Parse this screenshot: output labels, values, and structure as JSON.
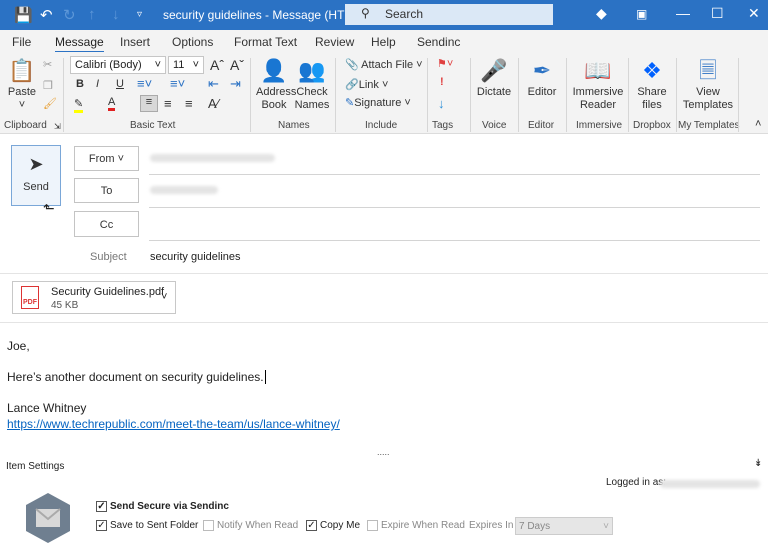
{
  "titlebar": {
    "title": "security guidelines  -  Message (HTML)",
    "search_placeholder": "Search",
    "icons": [
      "save-icon",
      "undo-icon",
      "redo-icon",
      "up-icon",
      "down-icon",
      "customize-icon",
      "diamond-icon",
      "restore-icon",
      "minimize-icon",
      "maximize-icon",
      "close-icon"
    ]
  },
  "tabs": [
    "File",
    "Message",
    "Insert",
    "Options",
    "Format Text",
    "Review",
    "Help",
    "Sendinc"
  ],
  "active_tab": "Message",
  "ribbon": {
    "paste": "Paste",
    "font": "Calibri (Body)",
    "size": "11",
    "address_book": [
      "Address",
      "Book"
    ],
    "check_names": [
      "Check",
      "Names"
    ],
    "attach_file": "Attach File",
    "link": "Link",
    "signature": "Signature",
    "dictate": "Dictate",
    "editor": "Editor",
    "immersive_reader": [
      "Immersive",
      "Reader"
    ],
    "share_files": [
      "Share",
      "files"
    ],
    "view_templates": [
      "View",
      "Templates"
    ],
    "groups": [
      "Clipboard",
      "Basic Text",
      "Names",
      "Include",
      "Tags",
      "Voice",
      "Editor",
      "Immersive",
      "Dropbox",
      "My Templates"
    ],
    "highlight_color": "#ffff00",
    "font_color": "#e02020"
  },
  "compose": {
    "send": "Send",
    "from": "From",
    "to": "To",
    "cc": "Cc",
    "subject_label": "Subject",
    "subject": "security guidelines"
  },
  "attachment": {
    "name": "Security Guidelines.pdf",
    "size": "45 KB",
    "type": "PDF"
  },
  "body": {
    "greeting": "Joe,",
    "line1": "Here’s another document on security guidelines.",
    "signature": "Lance Whitney",
    "link": "https://www.techrepublic.com/meet-the-team/us/lance-whitney/"
  },
  "sendinc": {
    "divider": ".....",
    "title": "Item Settings",
    "logged_in": "Logged in as:",
    "send_secure": "Send Secure via Sendinc",
    "save_sent": "Save to Sent Folder",
    "notify": "Notify When Read",
    "copy_me": "Copy Me",
    "expire": "Expire When Read",
    "expires_in": "Expires In",
    "expires_value": "7 Days",
    "checked": {
      "send_secure": true,
      "save_sent": true,
      "notify": false,
      "copy_me": true,
      "expire": false
    }
  }
}
